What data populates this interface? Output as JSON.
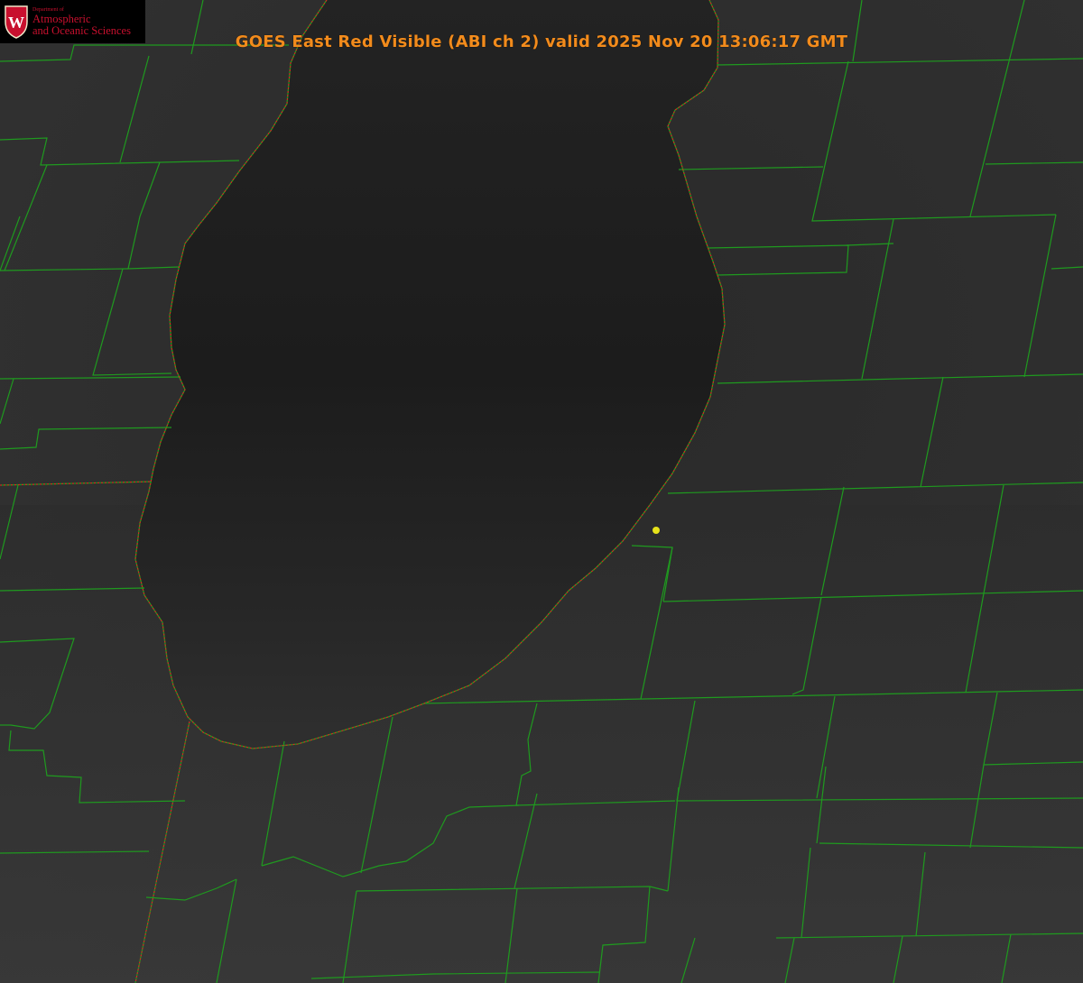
{
  "title": "GOES East Red Visible (ABI ch 2) valid 2025 Nov 20 13:06:17 GMT",
  "logo": {
    "crest_letter": "W",
    "dept_small": "Department of",
    "line1": "Atmospheric",
    "line2": "and Oceanic Sciences"
  },
  "colors": {
    "title": "#f28b1c",
    "county_lines": "#1f9a1f",
    "state_border": "#e02020",
    "marker": "#e6e21a",
    "logo_red": "#c8102e"
  },
  "icons": {
    "logo_crest": "uw-crest-icon",
    "marker": "location-dot-icon"
  }
}
